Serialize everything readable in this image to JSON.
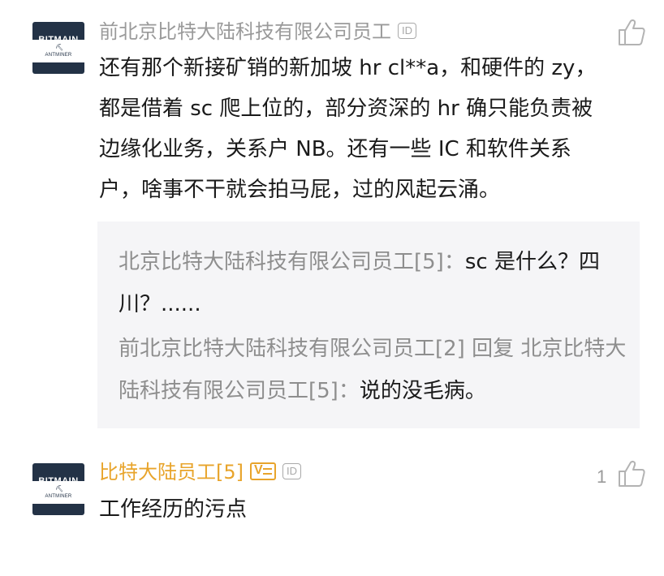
{
  "comments": [
    {
      "avatar": {
        "brand": "BITMAIN",
        "sub": "ANTMINER"
      },
      "author": "前北京比特大陆科技有限公司员工",
      "id_badge": "ID",
      "text": "还有那个新接矿销的新加坡 hr cl**a，和硬件的 zy，都是借着 sc 爬上位的，部分资深的 hr 确只能负责被边缘化业务，关系户 NB。还有一些 IC 和软件关系户，啥事不干就会拍马屁，过的风起云涌。",
      "replies": [
        {
          "author": "北京比特大陆科技有限公司员工[5]：",
          "text": "sc 是什么？四川？......"
        },
        {
          "author": "前北京比特大陆科技有限公司员工[2] 回复 北京比特大陆科技有限公司员工[5]：",
          "text": "说的没毛病。"
        }
      ]
    },
    {
      "avatar": {
        "brand": "BITMAIN",
        "sub": "ANTMINER"
      },
      "author": "比特大陆员工[5]",
      "verified_badge": "V",
      "id_badge": "ID",
      "like_count": "1",
      "text": "工作经历的污点"
    }
  ],
  "colors": {
    "author_gray": "#9a9a9a",
    "author_gold": "#e8a42b",
    "quote_bg": "#f5f5f7",
    "avatar_bg": "#233246"
  },
  "icons": {
    "like": "thumbs-up-icon"
  }
}
